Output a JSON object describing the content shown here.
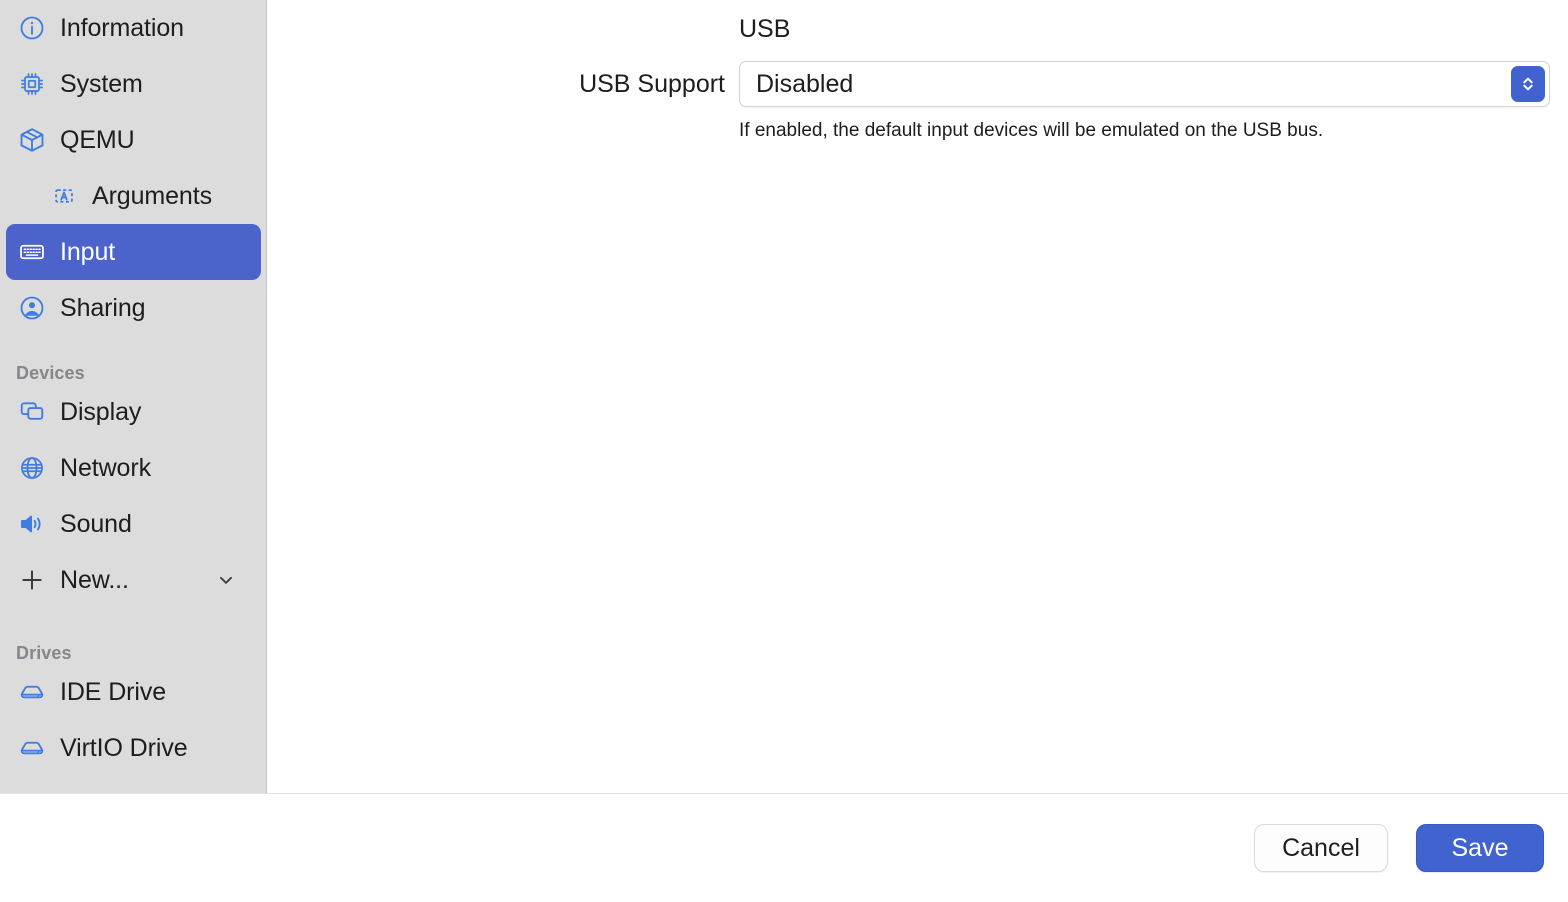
{
  "sidebar": {
    "items": [
      {
        "label": "Information",
        "icon": "info-circle-icon",
        "selected": false,
        "indented": false
      },
      {
        "label": "System",
        "icon": "cpu-chip-icon",
        "selected": false,
        "indented": false
      },
      {
        "label": "QEMU",
        "icon": "package-box-icon",
        "selected": false,
        "indented": false
      },
      {
        "label": "Arguments",
        "icon": "text-box-a-icon",
        "selected": false,
        "indented": true
      },
      {
        "label": "Input",
        "icon": "keyboard-icon",
        "selected": true,
        "indented": false
      },
      {
        "label": "Sharing",
        "icon": "person-circle-icon",
        "selected": false,
        "indented": false
      }
    ],
    "devices_header": "Devices",
    "devices": [
      {
        "label": "Display",
        "icon": "windows-stack-icon"
      },
      {
        "label": "Network",
        "icon": "globe-icon"
      },
      {
        "label": "Sound",
        "icon": "speaker-wave-icon"
      }
    ],
    "new_item": {
      "label": "New...",
      "icon": "plus-icon",
      "chevron": "chevron-down-icon"
    },
    "drives_header": "Drives",
    "drives": [
      {
        "label": "IDE Drive",
        "icon": "drive-icon"
      },
      {
        "label": "VirtIO Drive",
        "icon": "drive-icon"
      }
    ]
  },
  "main": {
    "group_title": "USB",
    "usb_support": {
      "label": "USB Support",
      "value": "Disabled",
      "stepper_icon": "chevron-up-down-icon",
      "helper_text": "If enabled, the default input devices will be emulated on the USB bus."
    }
  },
  "footer": {
    "cancel_label": "Cancel",
    "save_label": "Save"
  },
  "colors": {
    "accent": "#4063d0",
    "selection": "#4b63ca",
    "icon_blue": "#3f7ee0",
    "sidebar_bg": "#dcdcdc",
    "section_header": "#86868b",
    "text": "#1d1d1f"
  }
}
